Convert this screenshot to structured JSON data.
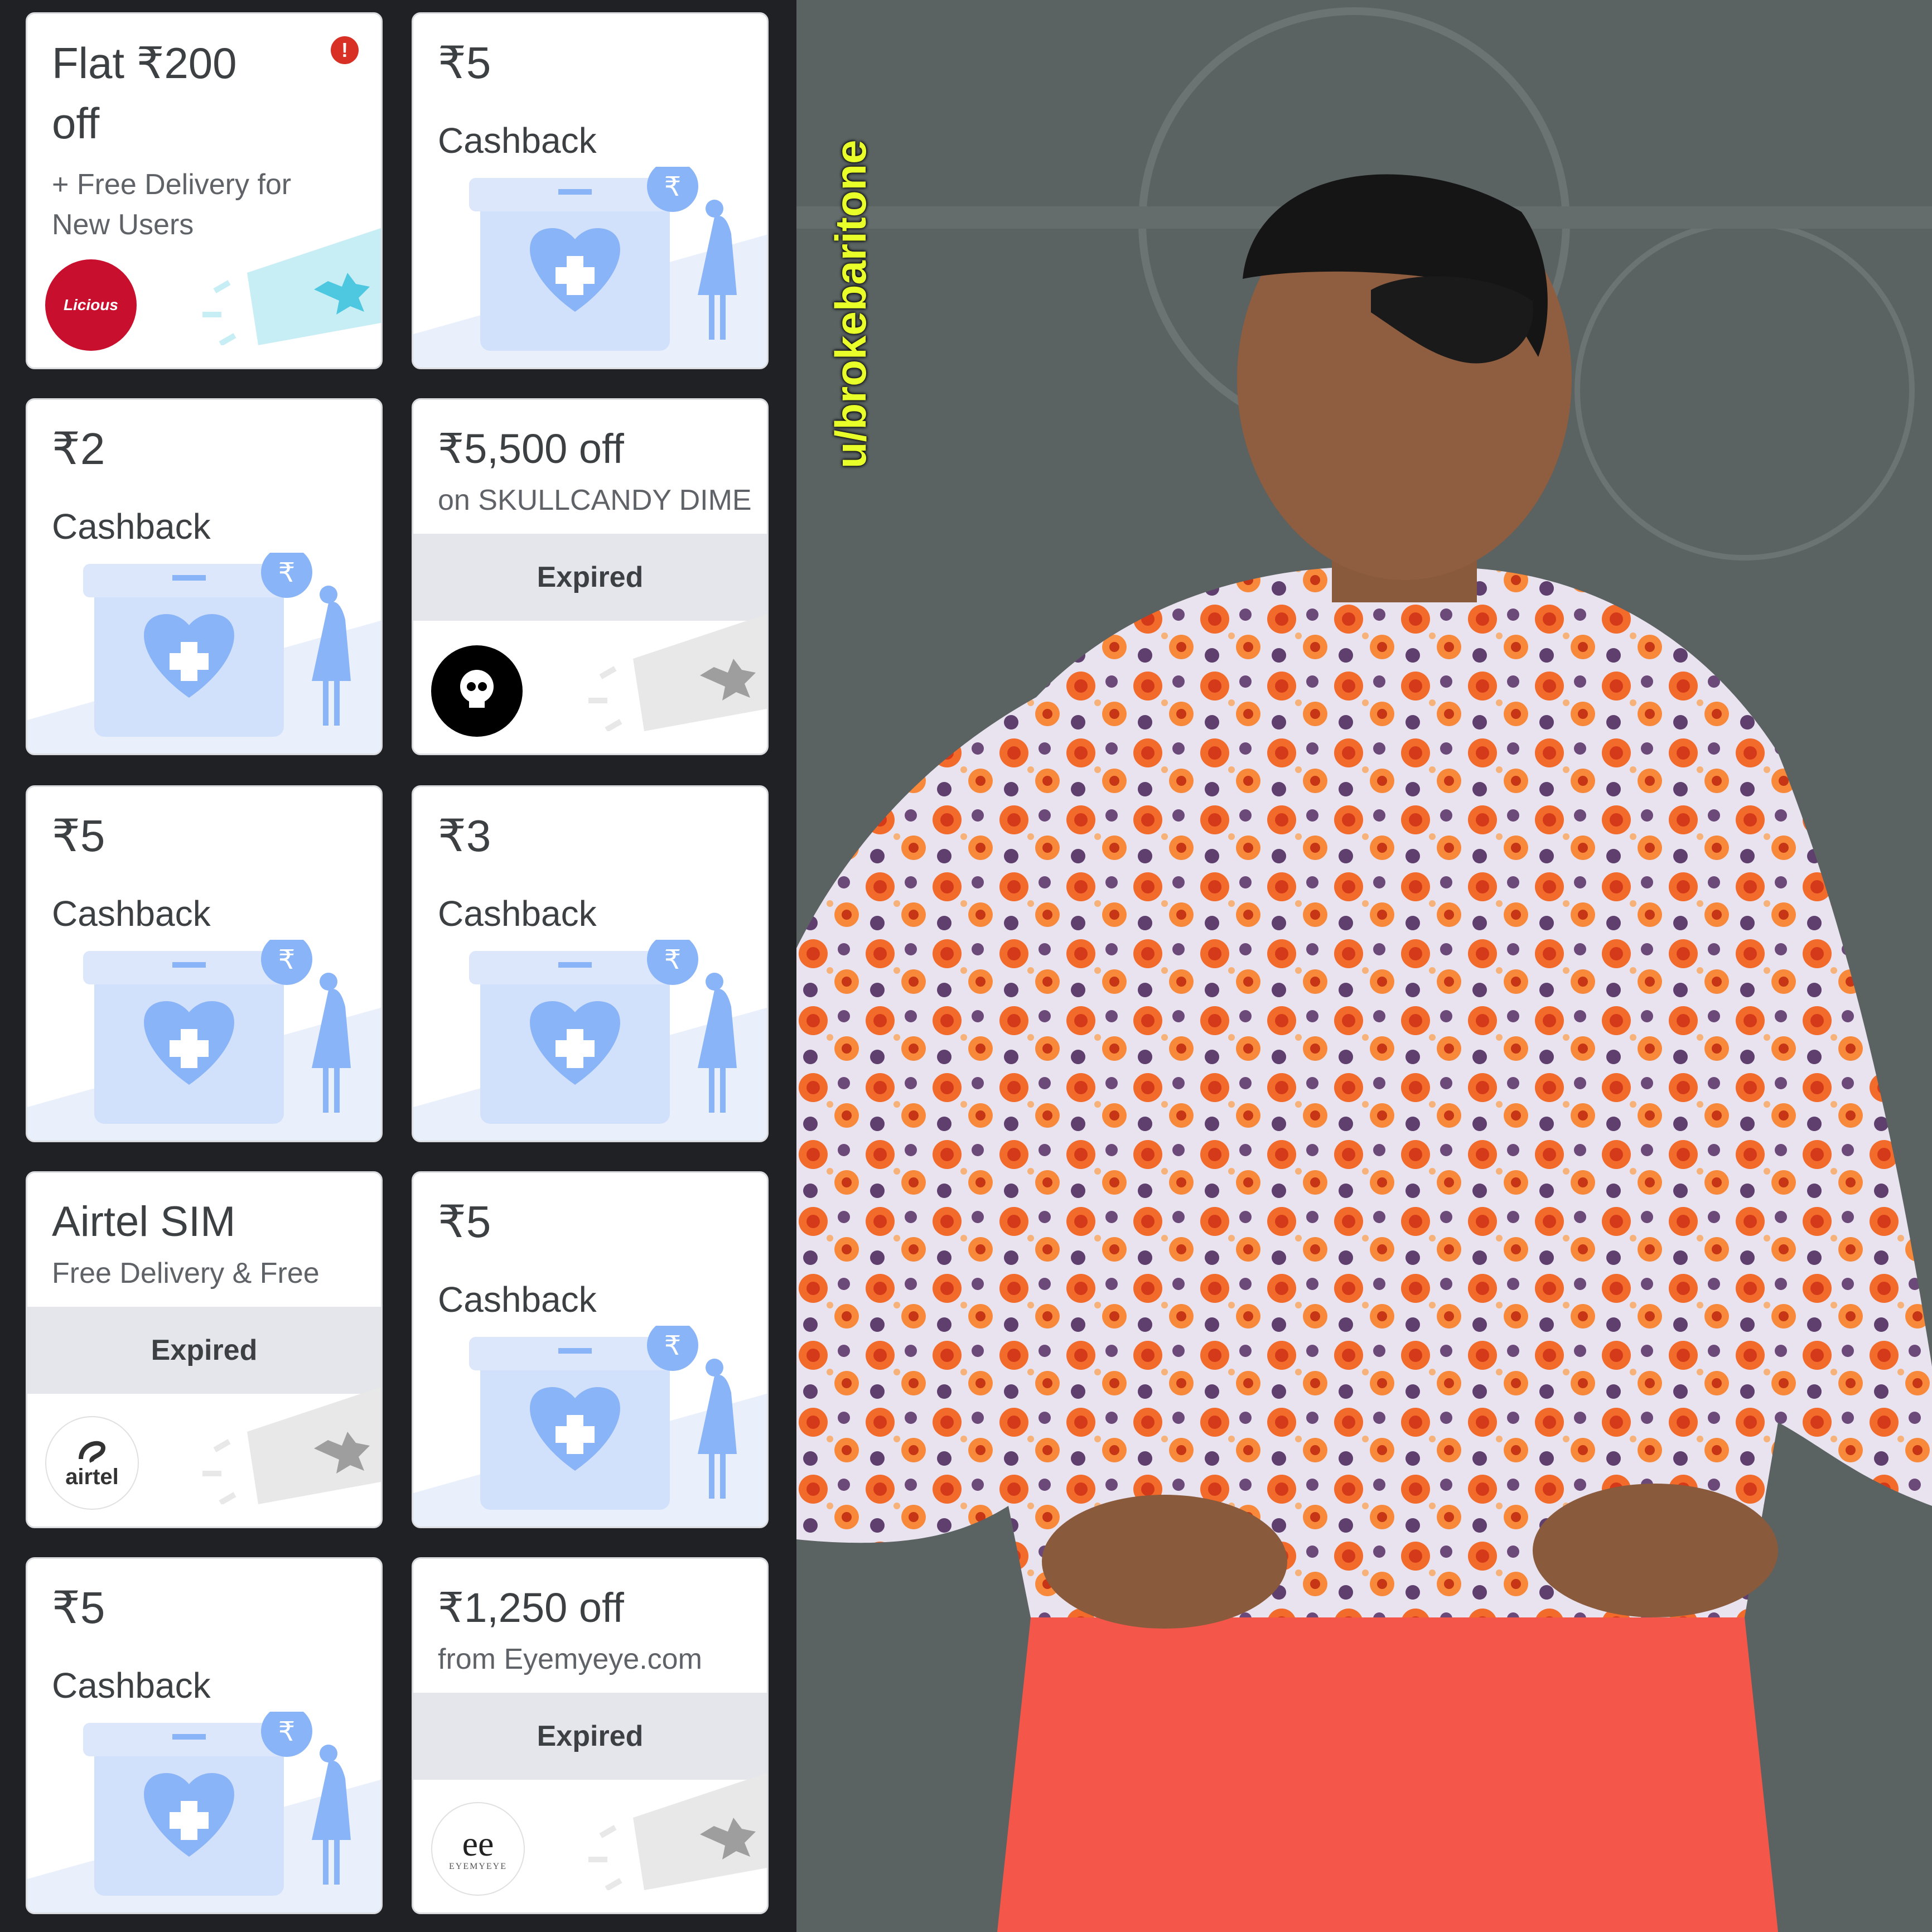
{
  "cards": [
    {
      "title_line1": "Flat ₹200",
      "title_line2": "off",
      "sub_line1": "+ Free Delivery for",
      "sub_line2": "New Users",
      "logo": "Licious",
      "alert": "!"
    },
    {
      "amount": "₹5",
      "label": "Cashback"
    },
    {
      "amount": "₹2",
      "label": "Cashback"
    },
    {
      "title": "₹5,500 off",
      "sub": "on SKULLCANDY DIME",
      "status": "Expired",
      "logo_icon": "skull-icon"
    },
    {
      "amount": "₹5",
      "label": "Cashback"
    },
    {
      "amount": "₹3",
      "label": "Cashback"
    },
    {
      "title": "Airtel SIM",
      "sub": "Free Delivery & Free",
      "status": "Expired",
      "logo": "airtel"
    },
    {
      "amount": "₹5",
      "label": "Cashback"
    },
    {
      "amount": "₹5",
      "label": "Cashback"
    },
    {
      "title": "₹1,250 off",
      "sub": "from Eyemyeye.com",
      "status": "Expired",
      "logo": "ee",
      "logo_sub": "EYEMYEYE"
    }
  ],
  "watermark": "u/brokebaritone",
  "colors": {
    "accent": "#8ab4f8",
    "alert": "#d93025",
    "licious": "#c8102e",
    "shirt_orange": "#f26b2a",
    "pants": "#f4574a"
  }
}
